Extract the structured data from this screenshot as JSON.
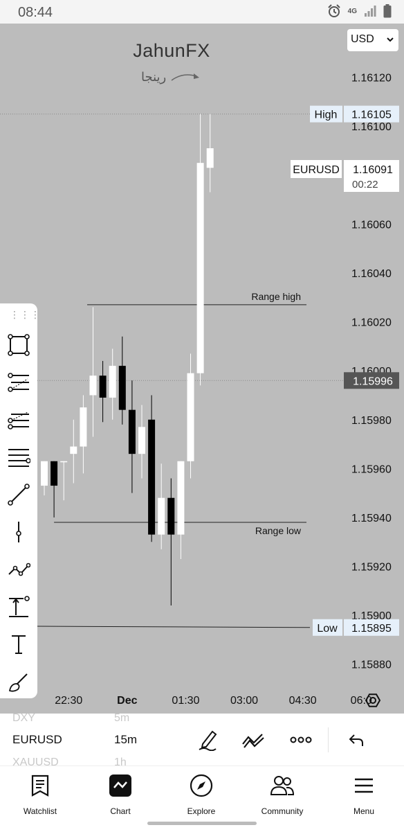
{
  "status": {
    "time": "08:44",
    "network": "4G"
  },
  "watermark": {
    "brand": "JahunFX",
    "sub": "رینجا"
  },
  "currency_select": {
    "value": "USD"
  },
  "chart_data": {
    "type": "candlestick",
    "symbol": "EURUSD",
    "countdown": "00:22",
    "ylim": [
      1.1587,
      1.16142
    ],
    "y_ticks": [
      1.1588,
      1.159,
      1.1592,
      1.1594,
      1.1596,
      1.1598,
      1.16,
      1.1602,
      1.1604,
      1.1606,
      1.1608,
      1.161,
      1.1612
    ],
    "y_tick_labels": [
      "1.15880",
      "1.15900",
      "1.15920",
      "1.15940",
      "1.15960",
      "1.15980",
      "1.16000",
      "1.16020",
      "1.16040",
      "1.16060",
      "1.16080",
      "1.16100",
      "1.16120"
    ],
    "x_ticks": [
      {
        "label": "22:30",
        "pos": 2.5
      },
      {
        "label": "Dec",
        "pos": 8.5
      },
      {
        "label": "01:30",
        "pos": 14.5
      },
      {
        "label": "03:00",
        "pos": 20.5
      },
      {
        "label": "04:30",
        "pos": 26.5
      },
      {
        "label": "06:0",
        "pos": 32.5
      }
    ],
    "candles": [
      {
        "o": 1.15953,
        "h": 1.15962,
        "l": 1.15949,
        "c": 1.15963
      },
      {
        "o": 1.15963,
        "h": 1.1596,
        "l": 1.1594,
        "c": 1.15953
      },
      {
        "o": 1.15963,
        "h": 1.15962,
        "l": 1.15947,
        "c": 1.15963
      },
      {
        "o": 1.15966,
        "h": 1.1598,
        "l": 1.15954,
        "c": 1.15969
      },
      {
        "o": 1.15969,
        "h": 1.1599,
        "l": 1.15958,
        "c": 1.15985
      },
      {
        "o": 1.1599,
        "h": 1.16026,
        "l": 1.15973,
        "c": 1.15998
      },
      {
        "o": 1.15998,
        "h": 1.16004,
        "l": 1.15979,
        "c": 1.15989
      },
      {
        "o": 1.15989,
        "h": 1.16009,
        "l": 1.1598,
        "c": 1.16002
      },
      {
        "o": 1.16002,
        "h": 1.16014,
        "l": 1.15978,
        "c": 1.15984
      },
      {
        "o": 1.15984,
        "h": 1.15996,
        "l": 1.1595,
        "c": 1.15966
      },
      {
        "o": 1.15966,
        "h": 1.15986,
        "l": 1.15956,
        "c": 1.15977
      },
      {
        "o": 1.1598,
        "h": 1.1599,
        "l": 1.1593,
        "c": 1.15933
      },
      {
        "o": 1.15933,
        "h": 1.15962,
        "l": 1.15927,
        "c": 1.15948
      },
      {
        "o": 1.15948,
        "h": 1.15956,
        "l": 1.15904,
        "c": 1.15933
      },
      {
        "o": 1.15933,
        "h": 1.15963,
        "l": 1.15923,
        "c": 1.15963
      },
      {
        "o": 1.15963,
        "h": 1.16007,
        "l": 1.15956,
        "c": 1.15999
      },
      {
        "o": 1.15999,
        "h": 1.16105,
        "l": 1.15994,
        "c": 1.16085
      },
      {
        "o": 1.16083,
        "h": 1.16105,
        "l": 1.16073,
        "c": 1.16091
      }
    ],
    "lines": {
      "high": {
        "label": "High",
        "value": 1.16105,
        "text": "1.16105"
      },
      "low": {
        "label": "Low",
        "value": 1.15895,
        "text": "1.15895"
      },
      "current": {
        "value": 1.15996,
        "text": "1.15996"
      },
      "last": {
        "text": "1.16091"
      },
      "range_high": {
        "label": "Range high",
        "value": 1.16027
      },
      "range_low": {
        "label": "Range low",
        "value": 1.15938
      }
    }
  },
  "drawing_tools": [
    "rectangle-tool-icon",
    "fib-retracement-icon",
    "fib-extension-icon",
    "parallel-lines-icon",
    "trend-line-icon",
    "vertical-line-icon",
    "pattern-icon",
    "measure-icon",
    "text-tool-icon",
    "brush-icon"
  ],
  "bottom_panel": {
    "faded_top_symbol": "DXY",
    "faded_top_tf": "5m",
    "symbol": "EURUSD",
    "timeframe": "15m",
    "faded_bottom_symbol": "XAUUSD",
    "faded_bottom_tf": "1h"
  },
  "nav": {
    "watchlist": "Watchlist",
    "chart": "Chart",
    "explore": "Explore",
    "community": "Community",
    "menu": "Menu"
  }
}
